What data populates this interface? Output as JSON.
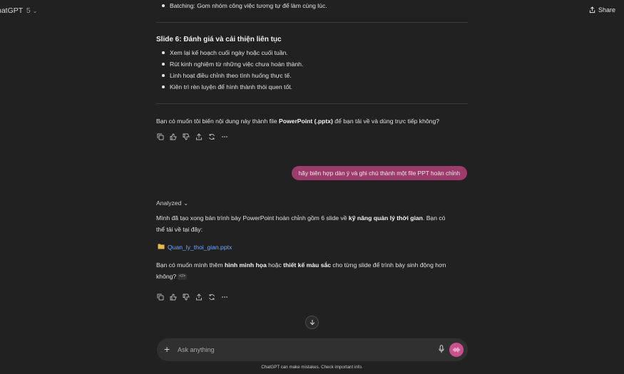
{
  "topbar": {
    "app_title": "hatGPT",
    "model_version": "5",
    "share_label": "Share"
  },
  "prev_list_items": [
    "Batching: Gom nhóm công việc tương tự để làm cùng lúc."
  ],
  "slide6": {
    "heading": "Slide 6: Đánh giá và cải thiện liên tục",
    "items": [
      "Xem lại kế hoạch cuối ngày hoặc cuối tuần.",
      "Rút kinh nghiệm từ những việc chưa hoàn thành.",
      "Linh hoạt điều chỉnh theo tình huống thực tế.",
      "Kiên trì rèn luyện để hình thành thói quen tốt."
    ]
  },
  "question1": {
    "before": "Bạn có muốn tôi biến nội dung này thành file ",
    "bold": "PowerPoint (.pptx)",
    "after": " để bạn tải về và dùng trực tiếp không?"
  },
  "user_message": "hãy biên hợp dàn ý và ghi chú thành một file PPT hoàn chỉnh",
  "assistant2": {
    "analyzed_label": "Analyzed",
    "p1_before": "Mình đã tạo xong bản trình bày PowerPoint hoàn chỉnh gồm 6 slide về ",
    "p1_bold": "kỹ năng quản lý thời gian",
    "p1_after": ". Bạn có",
    "p1_line2": "thể tải về tại đây:",
    "file_name": "Quan_ly_thoi_gian.pptx",
    "p2_before": "Bạn có muốn mình thêm ",
    "p2_bold1": "hình minh họa",
    "p2_mid": " hoặc ",
    "p2_bold2": "thiết kế màu sắc",
    "p2_after": " cho từng slide để trình bày sinh động hơn",
    "p2_line2": "không?",
    "code_badge": "</>"
  },
  "composer": {
    "placeholder": "Ask anything"
  },
  "footnote": "ChatGPT can make mistakes. Check important info.",
  "colors": {
    "background": "#212121",
    "user_bubble": "#9b3c6b",
    "voice_button": "#c9518d",
    "link": "#6ea8fe"
  },
  "icons": [
    "share-icon",
    "copy-icon",
    "thumbs-up-icon",
    "thumbs-down-icon",
    "share-icon",
    "regenerate-icon",
    "more-icon",
    "chevron-down-icon",
    "folder-icon",
    "arrow-down-icon",
    "plus-icon",
    "mic-icon",
    "voice-icon"
  ]
}
